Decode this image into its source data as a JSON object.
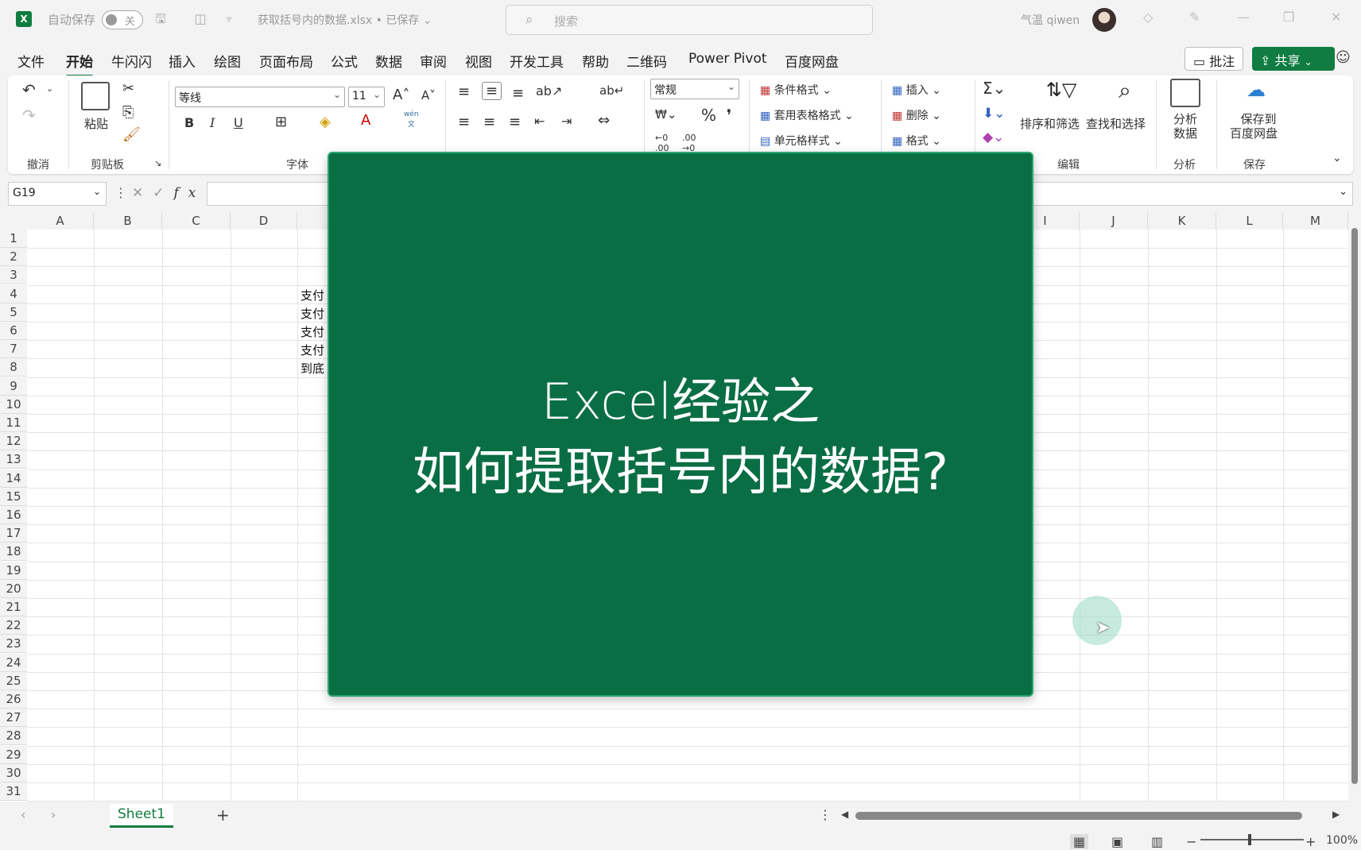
{
  "titlebar": {
    "autosave_label": "自动保存",
    "autosave_state": "关",
    "file_title": "获取括号内的数据.xlsx • 已保存 ⌄",
    "search_placeholder": "搜索",
    "user_name": "气温 qiwen"
  },
  "tabs": [
    "文件",
    "开始",
    "牛闪闪",
    "插入",
    "绘图",
    "页面布局",
    "公式",
    "数据",
    "审阅",
    "视图",
    "开发工具",
    "帮助",
    "二维码",
    "Power Pivot",
    "百度网盘"
  ],
  "active_tab": "开始",
  "actions": {
    "comment_label": "批注",
    "share_label": "共享"
  },
  "ribbon": {
    "groups": {
      "undo": "撤消",
      "clipboard": "剪贴板",
      "font": "字体",
      "editing": "编辑",
      "analyze": "分析",
      "save": "保存"
    },
    "paste_label": "粘贴",
    "font_name": "等线",
    "font_size": "11",
    "number_format": "常规",
    "cond_format": "条件格式",
    "table_format": "套用表格格式",
    "cell_style": "单元格样式",
    "insert": "插入",
    "delete": "删除",
    "format": "格式",
    "sort_filter": "排序和筛选",
    "find_select": "查找和选择",
    "analyze_data_1": "分析",
    "analyze_data_2": "数据",
    "save_baidu_1": "保存到",
    "save_baidu_2": "百度网盘",
    "bold": "B",
    "italic": "I",
    "underline": "U",
    "percent": "%",
    "comma": "❜",
    "wen": "wén",
    "wen2": "文"
  },
  "formula_bar": {
    "name_box": "G19",
    "fx": "fx",
    "value": ""
  },
  "grid": {
    "columns": [
      "A",
      "B",
      "C",
      "D",
      "I",
      "J",
      "K",
      "L",
      "M"
    ],
    "rows": [
      "1",
      "2",
      "3",
      "4",
      "5",
      "6",
      "7",
      "8",
      "9",
      "10",
      "11",
      "12",
      "13",
      "14",
      "15",
      "16",
      "17",
      "18",
      "19",
      "20",
      "21",
      "22",
      "23",
      "24",
      "25",
      "26",
      "27",
      "28",
      "29",
      "30",
      "31"
    ],
    "visible_cells": [
      {
        "row": "4",
        "text": "支付"
      },
      {
        "row": "5",
        "text": "支付"
      },
      {
        "row": "6",
        "text": "支付"
      },
      {
        "row": "7",
        "text": "支付"
      },
      {
        "row": "8",
        "text": "到底"
      }
    ]
  },
  "overlay": {
    "line1": "Excel经验之",
    "line2": "如何提取括号内的数据?"
  },
  "sheets": {
    "active": "Sheet1",
    "add_label": "+"
  },
  "status": {
    "zoom": "100%"
  },
  "colors": {
    "accent": "#107c41",
    "overlay_bg": "#0a6e44"
  }
}
